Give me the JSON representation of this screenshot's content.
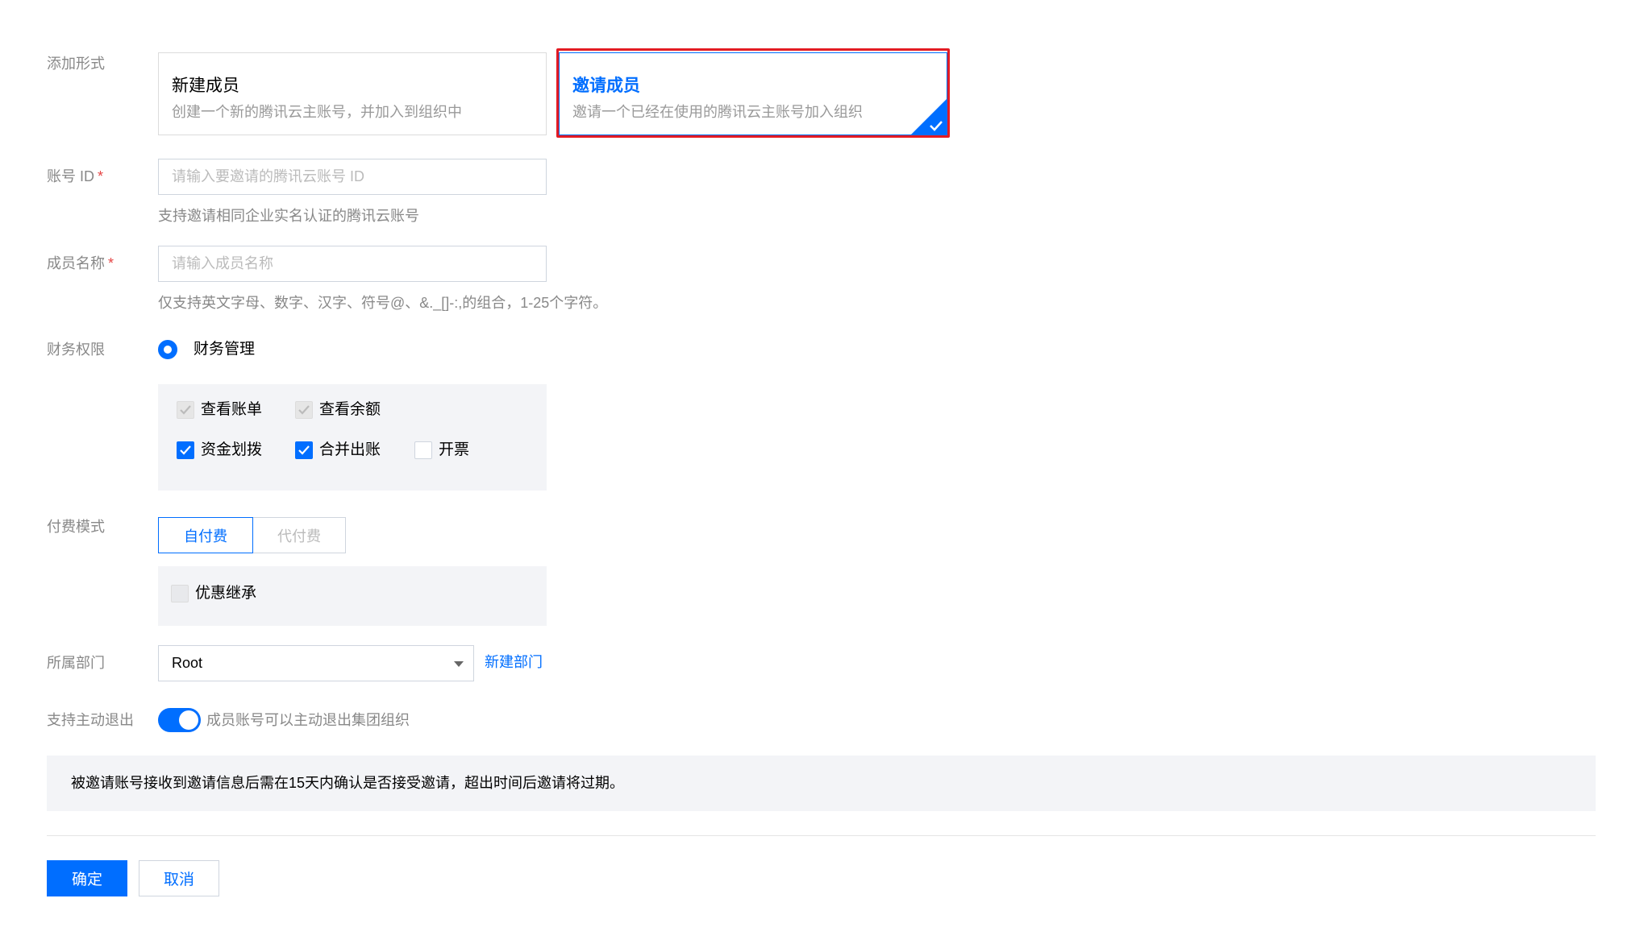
{
  "form": {
    "add_type": {
      "label": "添加形式",
      "options": [
        {
          "title": "新建成员",
          "desc": "创建一个新的腾讯云主账号，并加入到组织中"
        },
        {
          "title": "邀请成员",
          "desc": "邀请一个已经在使用的腾讯云主账号加入组织",
          "selected": true
        }
      ]
    },
    "account_id": {
      "label": "账号 ID",
      "required_mark": "*",
      "placeholder": "请输入要邀请的腾讯云账号 ID",
      "value": "",
      "hint": "支持邀请相同企业实名认证的腾讯云账号"
    },
    "member_name": {
      "label": "成员名称",
      "required_mark": "*",
      "placeholder": "请输入成员名称",
      "value": "",
      "hint": "仅支持英文字母、数字、汉字、符号@、&._[]-:,的组合，1-25个字符。"
    },
    "finance": {
      "label": "财务权限",
      "radio_label": "财务管理",
      "checkboxes": [
        {
          "label": "查看账单",
          "checked": true,
          "disabled": true
        },
        {
          "label": "查看余额",
          "checked": true,
          "disabled": true
        },
        {
          "label": "资金划拨",
          "checked": true,
          "disabled": false
        },
        {
          "label": "合并出账",
          "checked": true,
          "disabled": false
        },
        {
          "label": "开票",
          "checked": false,
          "disabled": false
        }
      ]
    },
    "payment": {
      "label": "付费模式",
      "modes": [
        "自付费",
        "代付费"
      ],
      "selected": "自付费",
      "inherit_label": "优惠继承",
      "inherit_checked": false
    },
    "department": {
      "label": "所属部门",
      "value": "Root",
      "new_link": "新建部门"
    },
    "quit": {
      "label": "支持主动退出",
      "enabled": true,
      "desc": "成员账号可以主动退出集团组织"
    },
    "notice": "被邀请账号接收到邀请信息后需在15天内确认是否接受邀请，超出时间后邀请将过期。",
    "actions": {
      "confirm": "确定",
      "cancel": "取消"
    }
  },
  "colors": {
    "accent": "#006eff",
    "required": "#e54545",
    "highlight_border": "#e31b23"
  }
}
